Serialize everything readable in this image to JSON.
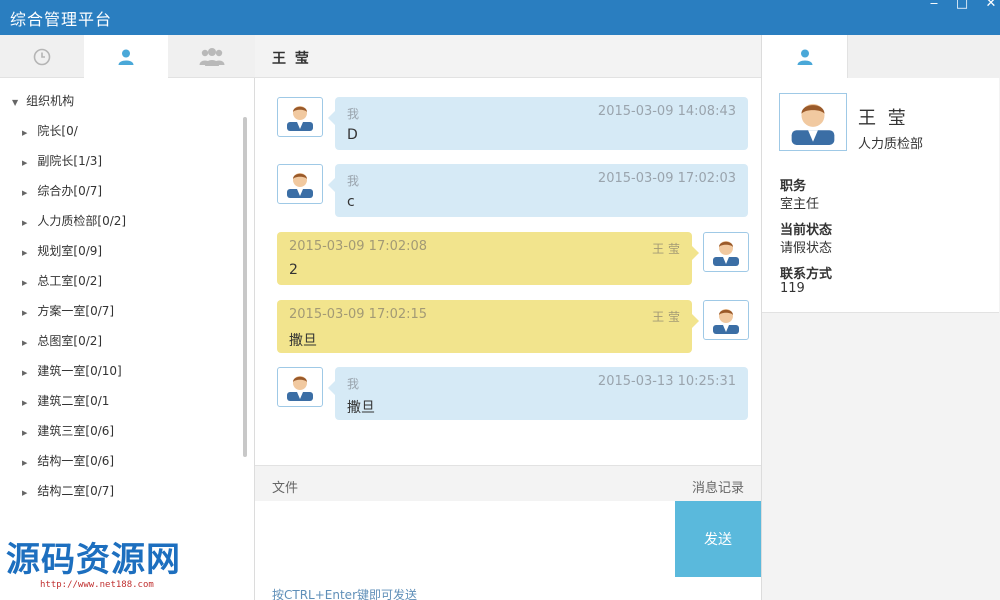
{
  "window": {
    "title": "综合管理平台",
    "controls": {
      "minimize": "‒",
      "maximize": "□",
      "close": "✕"
    }
  },
  "left_tabs": [
    {
      "icon": "clock-icon"
    },
    {
      "icon": "user-icon"
    },
    {
      "icon": "group-icon"
    }
  ],
  "tree": {
    "root": "组织机构",
    "items": [
      {
        "label": "院长[0/"
      },
      {
        "label": "副院长[1/3]"
      },
      {
        "label": "综合办[0/7]"
      },
      {
        "label": "人力质检部[0/2]"
      },
      {
        "label": "规划室[0/9]"
      },
      {
        "label": "总工室[0/2]"
      },
      {
        "label": "方案一室[0/7]"
      },
      {
        "label": "总图室[0/2]"
      },
      {
        "label": "建筑一室[0/10]"
      },
      {
        "label": "建筑二室[0/1"
      },
      {
        "label": "建筑三室[0/6]"
      },
      {
        "label": "结构一室[0/6]"
      },
      {
        "label": "结构二室[0/7]"
      }
    ]
  },
  "watermark": {
    "text": "源码资源网",
    "url": "http://www.net188.com"
  },
  "chat": {
    "contact_name": "王 莹",
    "messages": [
      {
        "side": "self",
        "sender": "我",
        "time": "2015-03-09 14:08:43",
        "text": "D"
      },
      {
        "side": "self",
        "sender": "我",
        "time": "2015-03-09 17:02:03",
        "text": "c"
      },
      {
        "side": "peer",
        "sender": "王 莹",
        "time": "2015-03-09 17:02:08",
        "text": "2"
      },
      {
        "side": "peer",
        "sender": "王 莹",
        "time": "2015-03-09 17:02:15",
        "text": "撒旦"
      },
      {
        "side": "self",
        "sender": "我",
        "time": "2015-03-13 10:25:31",
        "text": "撒旦"
      }
    ],
    "toolbar": {
      "file": "文件",
      "history": "消息记录"
    },
    "input_value": "",
    "send_label": "发送",
    "hint": "按CTRL+Enter键即可发送"
  },
  "profile": {
    "name": "王 莹",
    "department": "人力质检部",
    "fields": [
      {
        "label": "职务",
        "value": "室主任"
      },
      {
        "label": "当前状态",
        "value": "请假状态"
      },
      {
        "label": "联系方式",
        "value": "119"
      }
    ]
  },
  "colors": {
    "titlebar": "#2a7ec0",
    "self_bubble": "#d6eaf6",
    "peer_bubble": "#f2e48d",
    "send_button": "#5ab9dc",
    "icon_blue": "#4aa8d8"
  }
}
